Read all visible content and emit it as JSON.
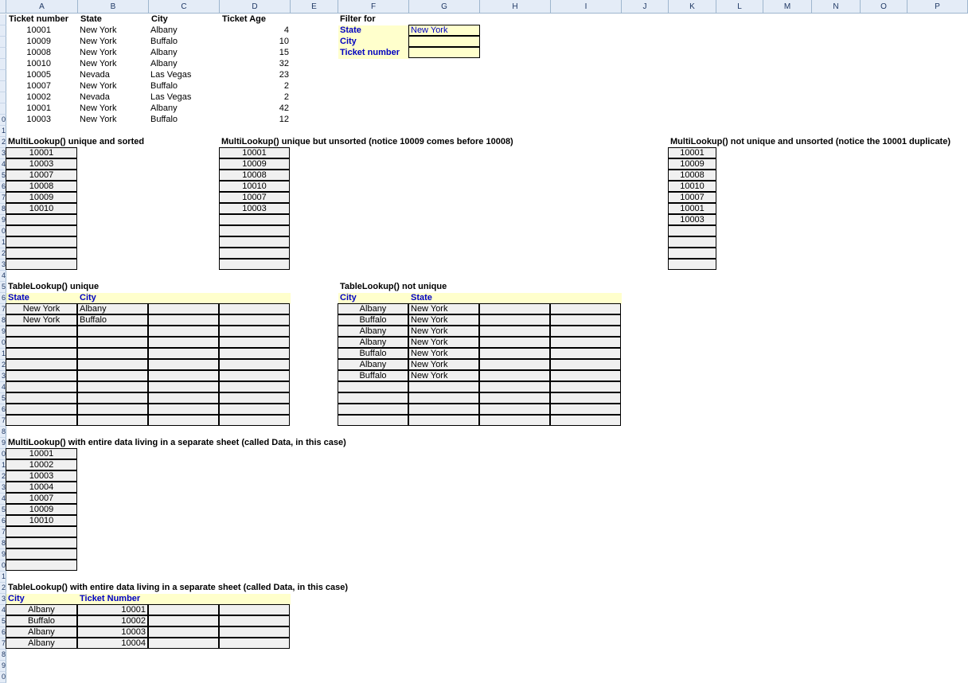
{
  "columns": [
    "A",
    "B",
    "C",
    "D",
    "E",
    "F",
    "G",
    "H",
    "I",
    "J",
    "K",
    "L",
    "M",
    "N",
    "O",
    "P"
  ],
  "rows": [
    "",
    "",
    "",
    "",
    "",
    "",
    "",
    "",
    "",
    "0",
    "1",
    "2",
    "3",
    "4",
    "5",
    "6",
    "7",
    "8",
    "9",
    "0",
    "1",
    "2",
    "3",
    "4",
    "5",
    "6",
    "7",
    "8",
    "9",
    "0",
    "1",
    "2",
    "3",
    "4",
    "5",
    "6",
    "7",
    "8",
    "9",
    "0",
    "1",
    "2",
    "3",
    "4",
    "5",
    "6",
    "7",
    "8",
    "9",
    "0",
    "1",
    "2",
    "3",
    "4",
    "5",
    "6",
    "7",
    "8",
    "9",
    "0"
  ],
  "table": {
    "headers": [
      "Ticket number",
      "State",
      "City",
      "Ticket Age"
    ],
    "rows": [
      [
        "10001",
        "New York",
        "Albany",
        "4"
      ],
      [
        "10009",
        "New York",
        "Buffalo",
        "10"
      ],
      [
        "10008",
        "New York",
        "Albany",
        "15"
      ],
      [
        "10010",
        "New York",
        "Albany",
        "32"
      ],
      [
        "10005",
        "Nevada",
        "Las Vegas",
        "23"
      ],
      [
        "10007",
        "New York",
        "Buffalo",
        "2"
      ],
      [
        "10002",
        "Nevada",
        "Las Vegas",
        "2"
      ],
      [
        "10001",
        "New York",
        "Albany",
        "42"
      ],
      [
        "10003",
        "New York",
        "Buffalo",
        "12"
      ]
    ]
  },
  "filter": {
    "title": "Filter for",
    "labels": [
      "State",
      "City",
      "Ticket number"
    ],
    "values": [
      "New York",
      "",
      ""
    ]
  },
  "ml_unique_sorted": {
    "title": "MultiLookup() unique and sorted",
    "values": [
      "10001",
      "10003",
      "10007",
      "10008",
      "10009",
      "10010",
      "",
      "",
      "",
      "",
      ""
    ]
  },
  "ml_unique_unsorted": {
    "title": "MultiLookup() unique but unsorted (notice 10009 comes before 10008)",
    "values": [
      "10001",
      "10009",
      "10008",
      "10010",
      "10007",
      "10003",
      "",
      "",
      "",
      "",
      ""
    ]
  },
  "ml_not_unique": {
    "title": "MultiLookup() not unique and unsorted (notice the 10001 duplicate)",
    "values": [
      "10001",
      "10009",
      "10008",
      "10010",
      "10007",
      "10001",
      "10003",
      "",
      "",
      "",
      ""
    ]
  },
  "tl_unique": {
    "title": "TableLookup() unique",
    "headers": [
      "State",
      "City"
    ],
    "rows": [
      [
        "New York",
        "Albany",
        "",
        ""
      ],
      [
        "New York",
        "Buffalo",
        "",
        ""
      ],
      [
        "",
        "",
        "",
        ""
      ],
      [
        "",
        "",
        "",
        ""
      ],
      [
        "",
        "",
        "",
        ""
      ],
      [
        "",
        "",
        "",
        ""
      ],
      [
        "",
        "",
        "",
        ""
      ],
      [
        "",
        "",
        "",
        ""
      ],
      [
        "",
        "",
        "",
        ""
      ],
      [
        "",
        "",
        "",
        ""
      ],
      [
        "",
        "",
        "",
        ""
      ]
    ]
  },
  "tl_not_unique": {
    "title": "TableLookup() not unique",
    "headers": [
      "City",
      "State"
    ],
    "rows": [
      [
        "Albany",
        "New York",
        "",
        ""
      ],
      [
        "Buffalo",
        "New York",
        "",
        ""
      ],
      [
        "Albany",
        "New York",
        "",
        ""
      ],
      [
        "Albany",
        "New York",
        "",
        ""
      ],
      [
        "Buffalo",
        "New York",
        "",
        ""
      ],
      [
        "Albany",
        "New York",
        "",
        ""
      ],
      [
        "Buffalo",
        "New York",
        "",
        ""
      ],
      [
        "",
        "",
        "",
        ""
      ],
      [
        "",
        "",
        "",
        ""
      ],
      [
        "",
        "",
        "",
        ""
      ],
      [
        "",
        "",
        "",
        ""
      ]
    ]
  },
  "ml_separate": {
    "title": "MultiLookup() with entire data living in a separate sheet (called Data, in this case)",
    "values": [
      "10001",
      "10002",
      "10003",
      "10004",
      "10007",
      "10009",
      "10010",
      "",
      "",
      "",
      ""
    ]
  },
  "tl_separate": {
    "title": "TableLookup() with entire data living in a separate sheet (called Data, in this case)",
    "headers": [
      "City",
      "Ticket Number"
    ],
    "rows": [
      [
        "Albany",
        "10001",
        "",
        ""
      ],
      [
        "Buffalo",
        "10002",
        "",
        ""
      ],
      [
        "Albany",
        "10003",
        "",
        ""
      ],
      [
        "Albany",
        "10004",
        "",
        ""
      ]
    ]
  }
}
